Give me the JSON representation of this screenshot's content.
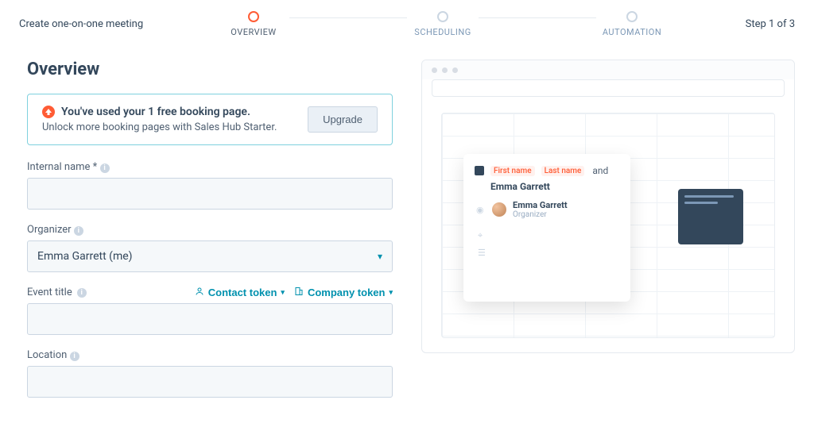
{
  "header": {
    "title": "Create one-on-one meeting",
    "step_indicator": "Step 1 of 3",
    "steps": [
      {
        "label": "OVERVIEW"
      },
      {
        "label": "SCHEDULING"
      },
      {
        "label": "AUTOMATION"
      }
    ]
  },
  "page": {
    "heading": "Overview"
  },
  "callout": {
    "title": "You've used your 1 free booking page.",
    "subtitle": "Unlock more booking pages with Sales Hub Starter.",
    "upgrade_label": "Upgrade"
  },
  "fields": {
    "internal_name": {
      "label": "Internal name *",
      "value": ""
    },
    "organizer": {
      "label": "Organizer",
      "value": "Emma Garrett (me)"
    },
    "event_title": {
      "label": "Event title",
      "value": "",
      "contact_token_label": "Contact token",
      "company_token_label": "Company token"
    },
    "location": {
      "label": "Location",
      "value": ""
    }
  },
  "preview": {
    "chip_first": "First name",
    "chip_last": "Last name",
    "and": "and",
    "subject_name": "Emma Garrett",
    "organizer_name": "Emma Garrett",
    "organizer_role": "Organizer"
  }
}
